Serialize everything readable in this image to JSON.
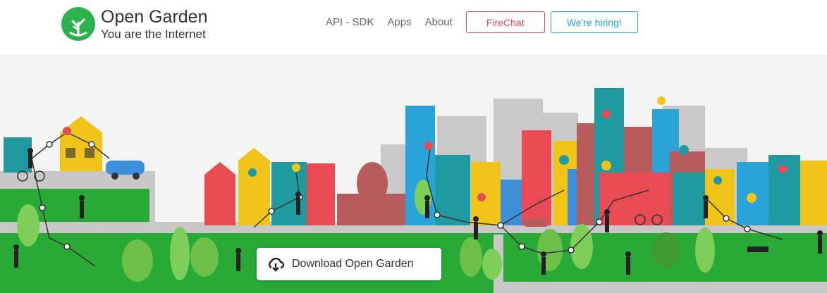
{
  "brand": {
    "name": "Open Garden",
    "tagline": "You are the Internet"
  },
  "nav": {
    "items": [
      "API - SDK",
      "Apps",
      "About"
    ],
    "firechat": "FireChat",
    "hiring": "We're hiring!"
  },
  "hero": {
    "download_label": "Download Open Garden"
  },
  "colors": {
    "brand_green": "#2bb24c",
    "firechat_red": "#e94b55",
    "hiring_blue": "#25a5d8",
    "grass": "#29a935",
    "road": "#c8c8c8"
  }
}
